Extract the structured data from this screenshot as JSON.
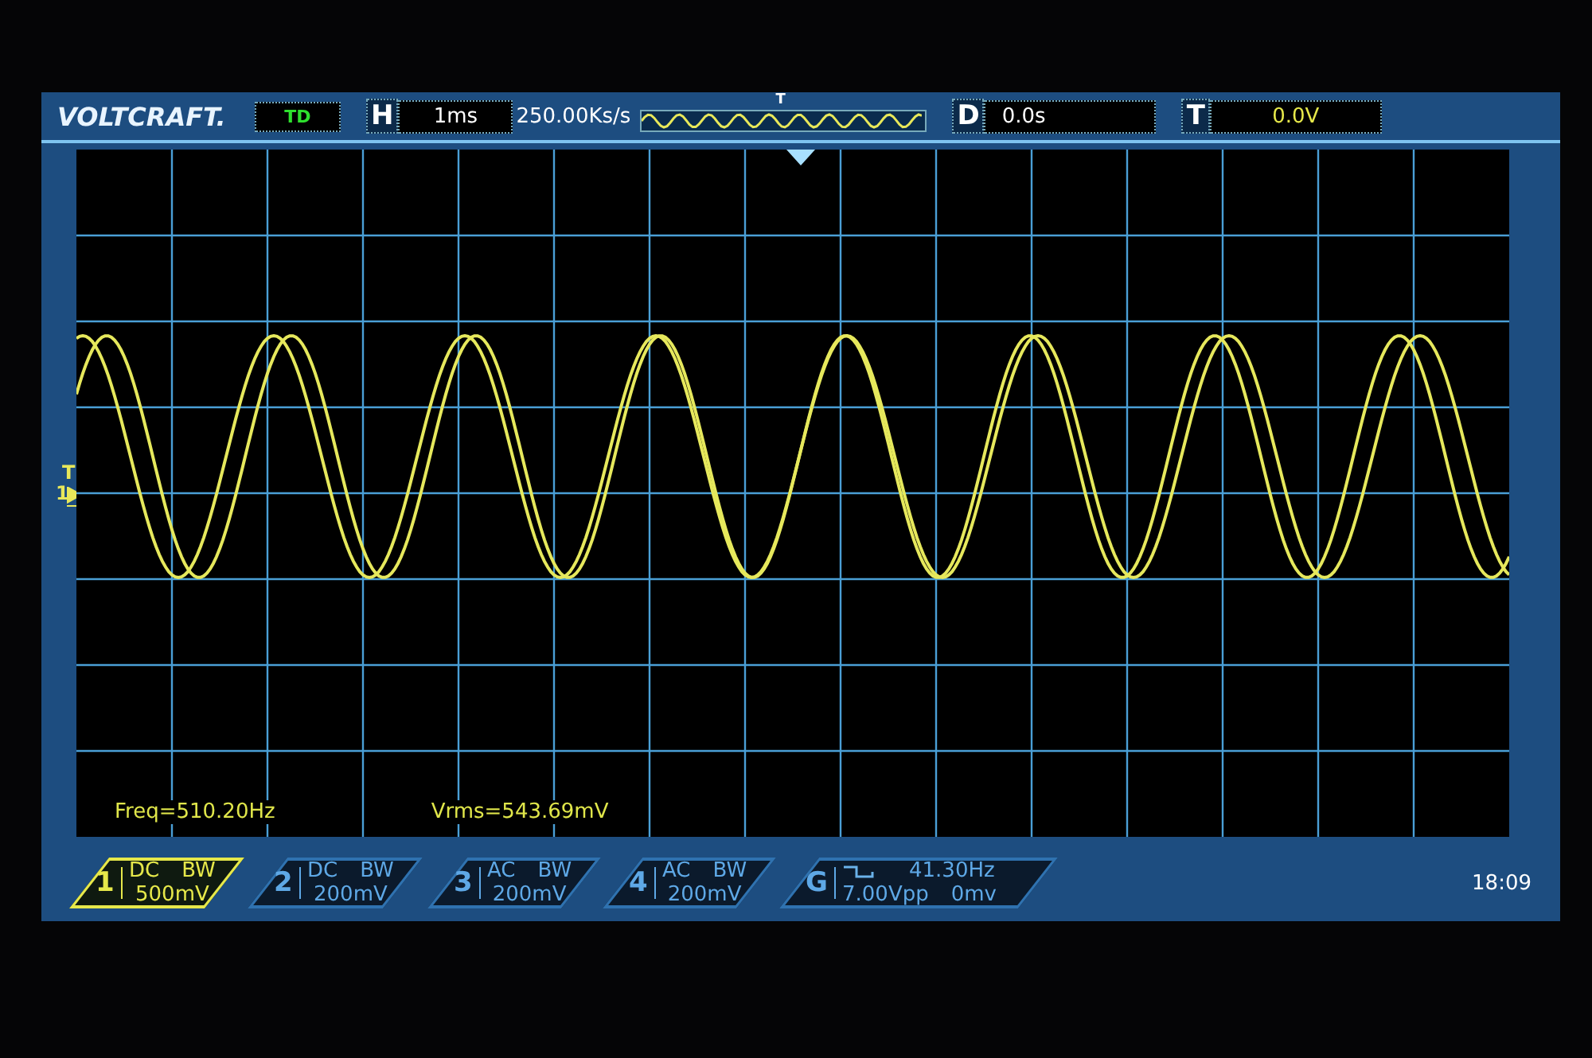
{
  "brand": "VOLTCRAFT.",
  "mode": "TD",
  "horizontal": {
    "label": "H",
    "value": "1ms"
  },
  "sample_rate": "250.00Ks/s",
  "preview": {
    "trigger_label": "T"
  },
  "delay": {
    "label": "D",
    "value": "0.0s"
  },
  "trigger": {
    "label": "T",
    "value": "0.0V"
  },
  "trigger_marker": {
    "label": "T",
    "channel": "1"
  },
  "measurements": [
    {
      "text": "Freq=510.20Hz"
    },
    {
      "text": "Vrms=543.69mV"
    }
  ],
  "channels": [
    {
      "number": "1",
      "coupling": "DC",
      "bandwidth": "BW",
      "scale": "500mV",
      "selected": true
    },
    {
      "number": "2",
      "coupling": "DC",
      "bandwidth": "BW",
      "scale": "200mV",
      "selected": false
    },
    {
      "number": "3",
      "coupling": "AC",
      "bandwidth": "BW",
      "scale": "200mV",
      "selected": false
    },
    {
      "number": "4",
      "coupling": "AC",
      "bandwidth": "BW",
      "scale": "200mV",
      "selected": false
    }
  ],
  "generator": {
    "label": "G",
    "frequency": "41.30Hz",
    "amplitude": "7.00Vpp",
    "offset": "0mv"
  },
  "clock": "18:09"
}
